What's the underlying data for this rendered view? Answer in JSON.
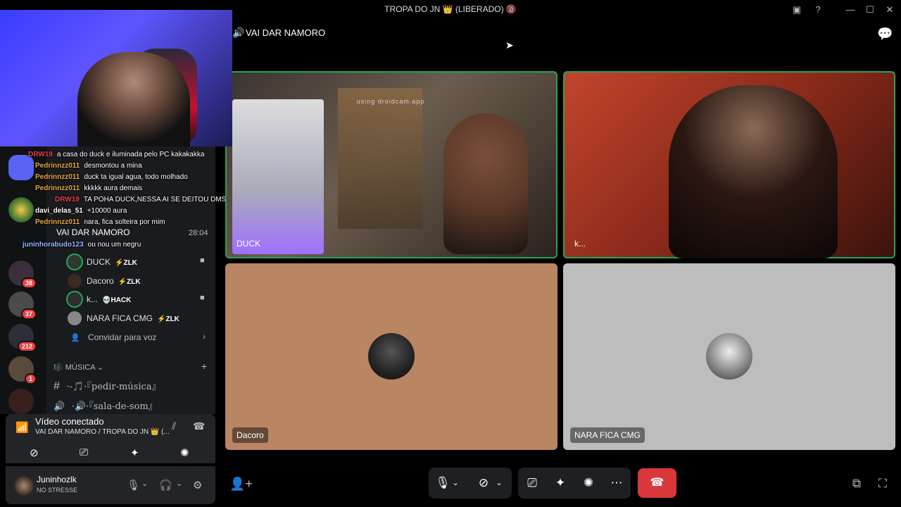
{
  "window": {
    "title": "TROPA DO JN 👑 (LIBERADO) 🔞"
  },
  "channel_header": {
    "name": "VAI DAR NAMORO"
  },
  "stage": {
    "tiles": [
      {
        "name": "DUCK",
        "overlay_text": "using droidcam.app",
        "speaking": true
      },
      {
        "name": "k...",
        "speaking": true
      },
      {
        "name": "Dacoro",
        "speaking": false,
        "bg": "#b98563"
      },
      {
        "name": "NARA FICA CMG",
        "speaking": false,
        "bg": "#bdbdbd"
      }
    ]
  },
  "sidebar": {
    "voice_channel": {
      "name": "VAI DAR NAMORO",
      "timer": "28:04",
      "subtitle": "ou nou um negru"
    },
    "members": [
      {
        "name": "DUCK",
        "tag": "ZLK",
        "tag_icon": "⚡",
        "video": true
      },
      {
        "name": "Dacoro",
        "tag": "ZLK",
        "tag_icon": "⚡",
        "video": false
      },
      {
        "name": "k...",
        "tag": "HACK",
        "tag_icon": "💀",
        "video": true
      },
      {
        "name": "NARA FICA CMG",
        "tag": "ZLK",
        "tag_icon": "⚡",
        "video": false
      }
    ],
    "invite_label": "Convidar para voz",
    "category": "MÚSICA",
    "channels": [
      {
        "icon": "#",
        "name": "·-🎵·『pedir-música』"
      },
      {
        "icon": "🔊",
        "name": "·🔊·『sala-de-som』"
      }
    ],
    "server_badges": [
      "38",
      "37",
      "212",
      "1"
    ]
  },
  "chat_overlay": [
    {
      "user": "DRW19",
      "msg": "a casa do duck e iluminada pelo PC kakakakka",
      "color": "#e0424a"
    },
    {
      "user": "Pedrinnzz011",
      "msg": "desmontou a mina",
      "color": "#e7a73a"
    },
    {
      "user": "Pedrinnzz011",
      "msg": "duck ta igual agua, todo molhado",
      "color": "#e7a73a"
    },
    {
      "user": "Pedrinnzz011",
      "msg": "kkkkk aura demais",
      "color": "#e7a73a"
    },
    {
      "user": "DRW19",
      "msg": "TA POHA DUCK,NESSA AI SE DEITOU DMS",
      "color": "#e0424a"
    },
    {
      "user": "davi_delas_51",
      "msg": "+10000 aura",
      "color": "#ffffff"
    },
    {
      "user": "Pedrinnzz011",
      "msg": "nara, fica solteira por mim",
      "color": "#e7a73a"
    },
    {
      "user": "juninhorabudo123",
      "msg": "ou nou um negru",
      "color": "#8fb4ff"
    }
  ],
  "voice_panel": {
    "status": "Vídeo conectado",
    "location": "VAI DAR NAMORO / TROPA DO JN 👑 (..."
  },
  "user_panel": {
    "username": "Juninhozlk",
    "status": "NO STRESSE"
  },
  "colors": {
    "accent_green": "#23a55a",
    "hangup_red": "#da373c",
    "badge_red": "#f23f43"
  }
}
